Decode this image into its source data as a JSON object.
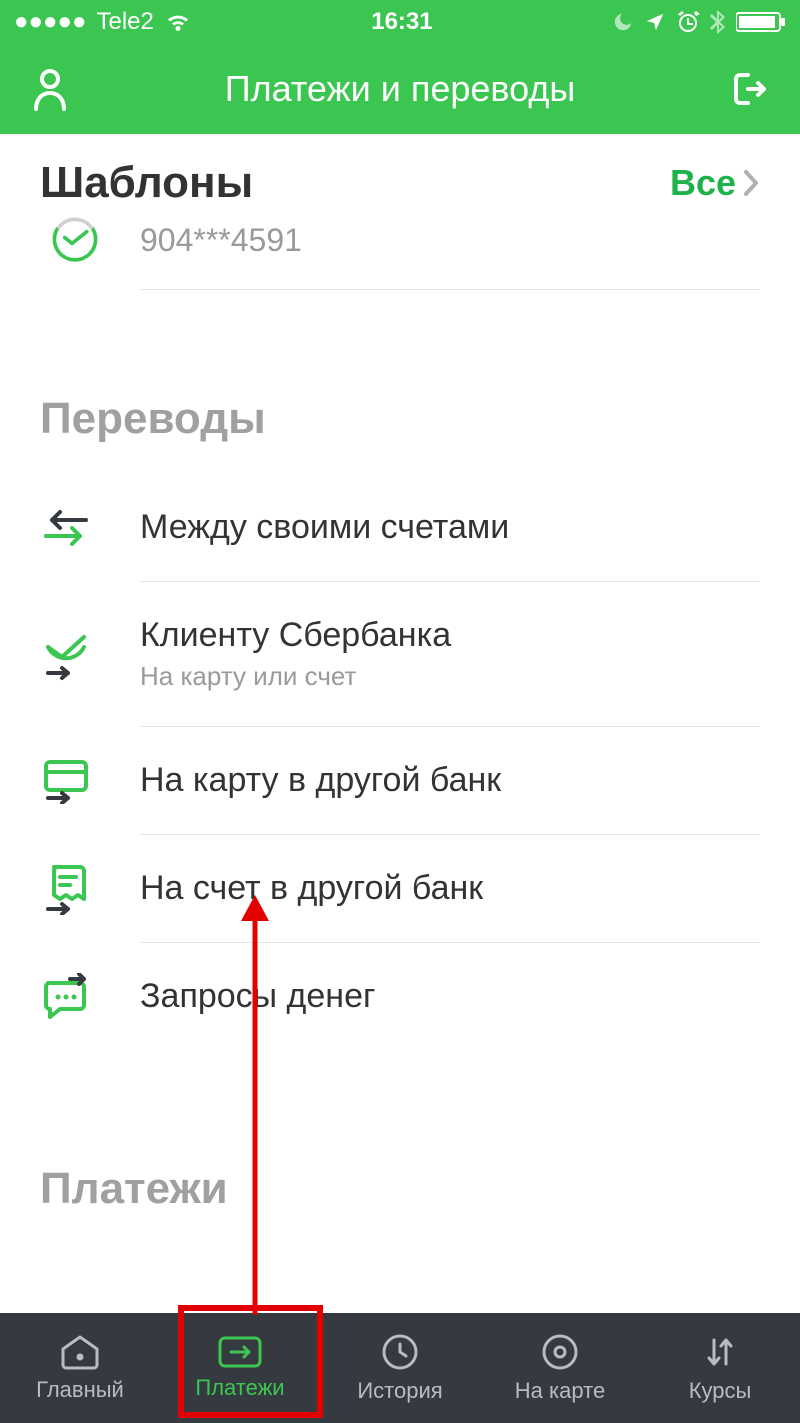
{
  "status": {
    "carrier": "Tele2",
    "time": "16:31"
  },
  "nav": {
    "title": "Платежи и переводы"
  },
  "templates": {
    "title": "Шаблоны",
    "all_label": "Все",
    "item_number": "904***4591"
  },
  "transfers": {
    "title": "Переводы",
    "items": [
      {
        "title": "Между своими счетами",
        "sub": ""
      },
      {
        "title": "Клиенту Сбербанка",
        "sub": "На карту или счет"
      },
      {
        "title": "На карту в другой банк",
        "sub": ""
      },
      {
        "title": "На счет в другой банк",
        "sub": ""
      },
      {
        "title": "Запросы денег",
        "sub": ""
      }
    ]
  },
  "payments": {
    "title": "Платежи"
  },
  "tabs": [
    {
      "label": "Главный"
    },
    {
      "label": "Платежи"
    },
    {
      "label": "История"
    },
    {
      "label": "На карте"
    },
    {
      "label": "Курсы"
    }
  ]
}
